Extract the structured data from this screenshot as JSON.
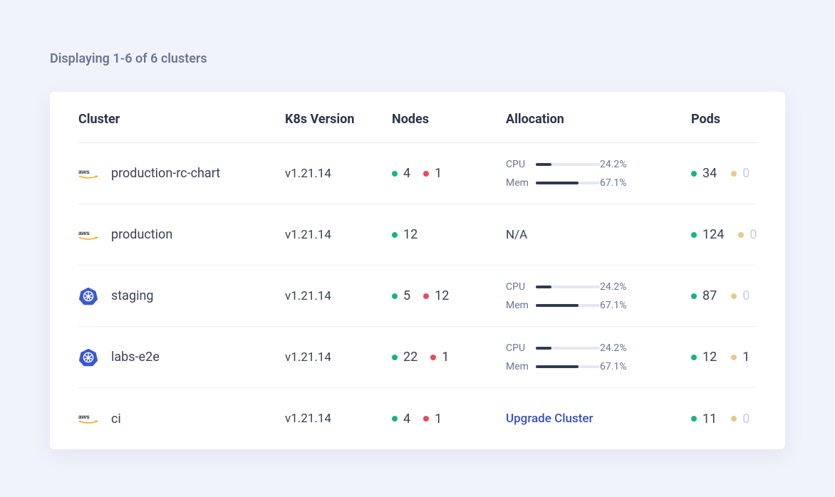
{
  "summary": "Displaying 1-6 of 6 clusters",
  "columns": {
    "cluster": "Cluster",
    "version": "K8s Version",
    "nodes": "Nodes",
    "allocation": "Allocation",
    "pods": "Pods"
  },
  "allocation_labels": {
    "cpu": "CPU",
    "mem": "Mem"
  },
  "allocation_na": "N/A",
  "upgrade_label": "Upgrade Cluster",
  "colors": {
    "green": "#18b383",
    "red": "#e84a5f",
    "amber": "#e6c98c",
    "bar": "#2f3a52",
    "link": "#3451c6"
  },
  "rows": [
    {
      "provider": "aws",
      "name": "production-rc-chart",
      "version": "v1.21.14",
      "nodes_green": "4",
      "nodes_red": "1",
      "alloc": {
        "cpu_pct": "24.2%",
        "cpu_bar": 24.2,
        "mem_pct": "67.1%",
        "mem_bar": 67.1
      },
      "pods_green": "34",
      "pods_amber": "0"
    },
    {
      "provider": "aws",
      "name": "production",
      "version": "v1.21.14",
      "nodes_green": "12",
      "nodes_red": null,
      "alloc": null,
      "pods_green": "124",
      "pods_amber": "0"
    },
    {
      "provider": "k8s",
      "name": "staging",
      "version": "v1.21.14",
      "nodes_green": "5",
      "nodes_red": "12",
      "alloc": {
        "cpu_pct": "24.2%",
        "cpu_bar": 24.2,
        "mem_pct": "67.1%",
        "mem_bar": 67.1
      },
      "pods_green": "87",
      "pods_amber": "0"
    },
    {
      "provider": "k8s",
      "name": "labs-e2e",
      "version": "v1.21.14",
      "nodes_green": "22",
      "nodes_red": "1",
      "alloc": {
        "cpu_pct": "24.2%",
        "cpu_bar": 24.2,
        "mem_pct": "67.1%",
        "mem_bar": 67.1
      },
      "pods_green": "12",
      "pods_amber": "1"
    },
    {
      "provider": "aws",
      "name": "ci",
      "version": "v1.21.14",
      "nodes_green": "4",
      "nodes_red": "1",
      "upgrade": true,
      "pods_green": "11",
      "pods_amber": "0"
    }
  ]
}
